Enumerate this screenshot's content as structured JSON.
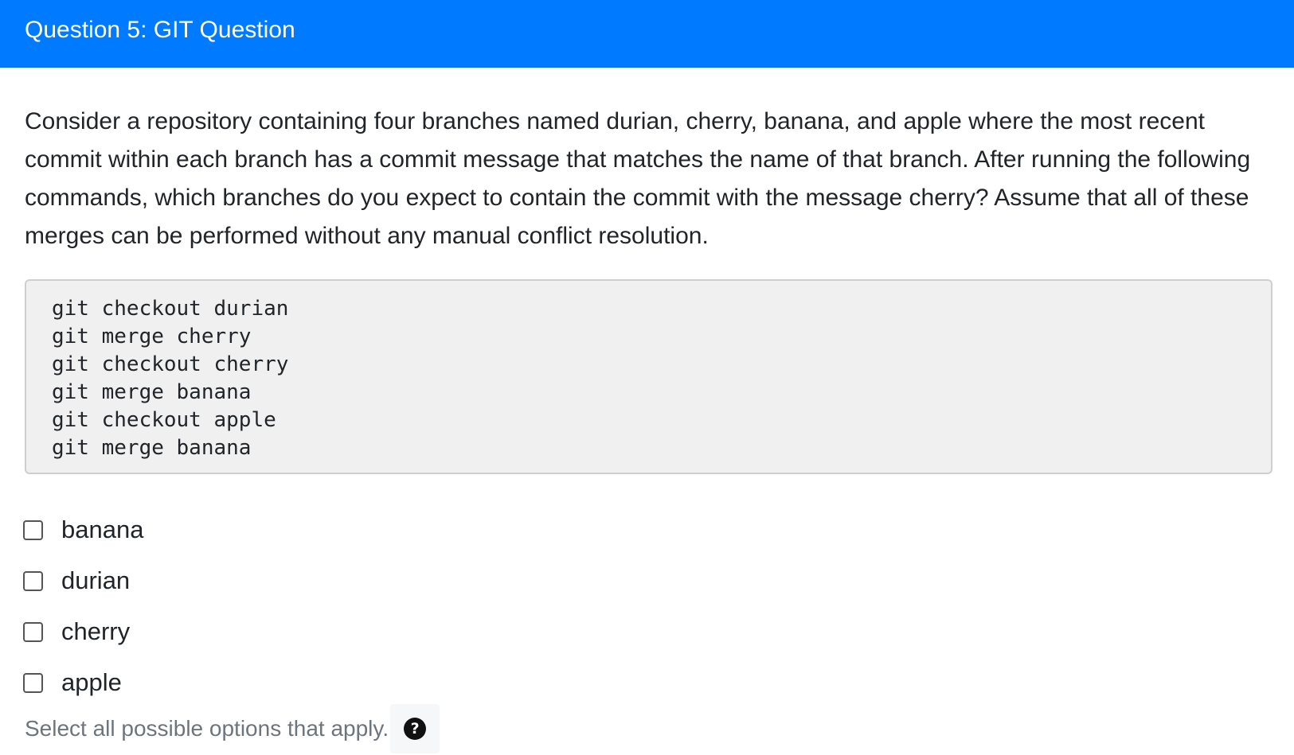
{
  "header": {
    "title": "Question 5: GIT Question",
    "background_color": "#007bff"
  },
  "question": {
    "text": "Consider a repository containing four branches named durian, cherry, banana, and apple where the most recent commit within each branch has a commit message that matches the name of that branch. After running the following commands, which branches do you expect to contain the commit with the message cherry? Assume that all of these merges can be performed without any manual conflict resolution."
  },
  "code": {
    "lines": [
      "git checkout durian",
      "git merge cherry",
      "git checkout cherry",
      "git merge banana",
      "git checkout apple",
      "git merge banana"
    ]
  },
  "options": [
    {
      "label": "banana",
      "checked": false
    },
    {
      "label": "durian",
      "checked": false
    },
    {
      "label": "cherry",
      "checked": false
    },
    {
      "label": "apple",
      "checked": false
    }
  ],
  "footer": {
    "hint": "Select all possible options that apply.",
    "help_icon": "question-circle-icon",
    "help_glyph": "?"
  }
}
